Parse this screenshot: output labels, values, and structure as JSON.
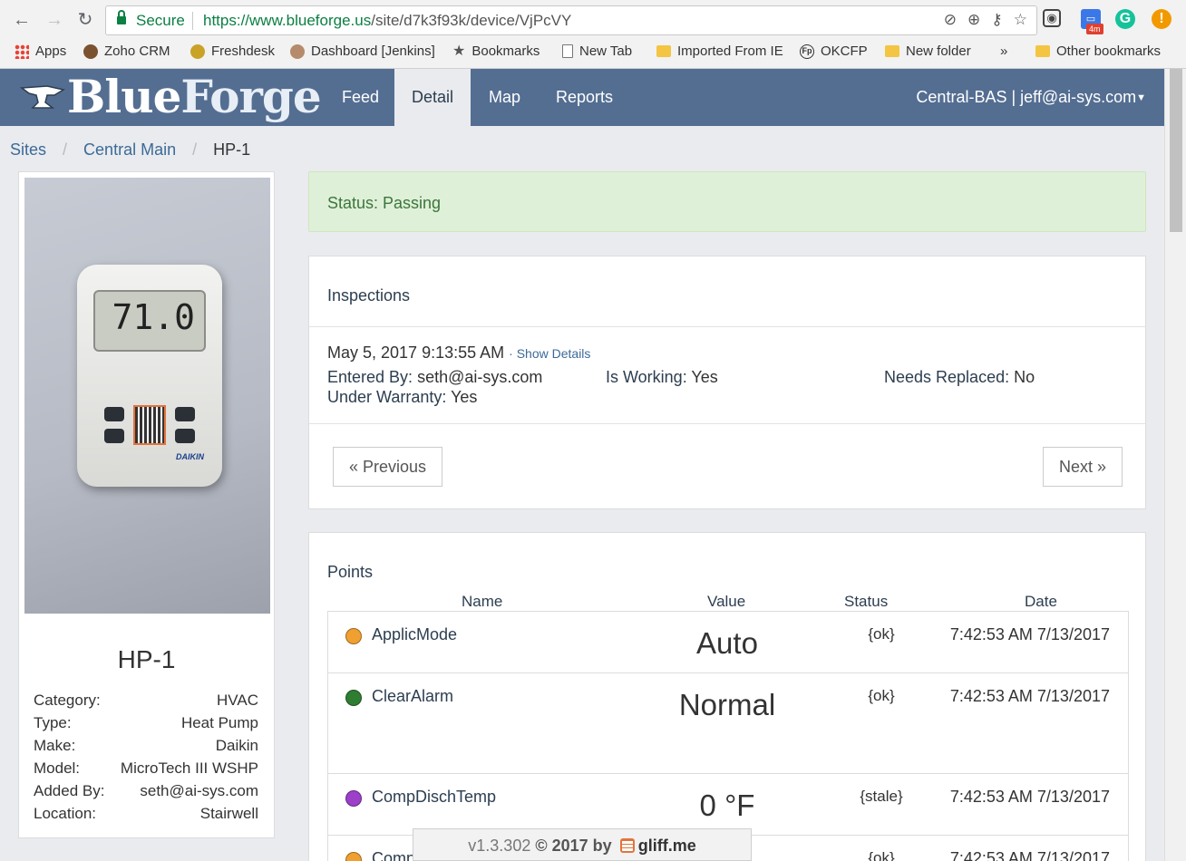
{
  "browser": {
    "secure_label": "Secure",
    "url_host": "https://www.blueforge.us",
    "url_path": "/site/d7k3f93k/device/VjPcVY",
    "bookmarks": [
      "Apps",
      "Zoho CRM",
      "Freshdesk",
      "Dashboard [Jenkins]",
      "Bookmarks",
      "New Tab",
      "Imported From IE",
      "OKCFP",
      "New folder",
      "»",
      "Other bookmarks"
    ],
    "ext_badge": "4m"
  },
  "header": {
    "logo_blue": "Blue",
    "logo_forge": "Forge",
    "nav": [
      "Feed",
      "Detail",
      "Map",
      "Reports"
    ],
    "account": "Central-BAS | jeff@ai-sys.com"
  },
  "breadcrumb": [
    "Sites",
    "Central Main",
    "HP-1"
  ],
  "device": {
    "photo_temp": "71.0",
    "photo_brand": "DAIKIN",
    "name": "HP-1",
    "specs": [
      {
        "label": "Category:",
        "value": "HVAC"
      },
      {
        "label": "Type:",
        "value": "Heat Pump"
      },
      {
        "label": "Make:",
        "value": "Daikin"
      },
      {
        "label": "Model:",
        "value": "MicroTech III WSHP"
      },
      {
        "label": "Added By:",
        "value": "seth@ai-sys.com"
      },
      {
        "label": "Location:",
        "value": "Stairwell"
      }
    ]
  },
  "status": "Status: Passing",
  "inspections": {
    "title": "Inspections",
    "date": "May 5, 2017 9:13:55 AM",
    "show_details": "· Show Details",
    "entered_by_label": "Entered By:",
    "entered_by": "seth@ai-sys.com",
    "is_working_label": "Is Working:",
    "is_working": "Yes",
    "needs_replaced_label": "Needs Replaced:",
    "needs_replaced": "No",
    "warranty_label": "Under Warranty:",
    "warranty": "Yes",
    "prev": "« Previous",
    "next": "Next »"
  },
  "points": {
    "title": "Points",
    "headers": [
      "Name",
      "Value",
      "Status",
      "Date"
    ],
    "rows": [
      {
        "name": "ApplicMode",
        "value": "Auto",
        "status": "{ok}",
        "date": "7:42:53 AM 7/13/2017",
        "color": "#f0a030"
      },
      {
        "name": "ClearAlarm",
        "value": "Normal",
        "status": "{ok}",
        "date": "7:42:53 AM 7/13/2017",
        "color": "#2e7d32"
      },
      {
        "name": "CompDischTemp",
        "value": "0 °F",
        "status": "{stale}",
        "date": "7:42:53 AM 7/13/2017",
        "color": "#9c3fc9"
      },
      {
        "name": "Comp",
        "value": "",
        "status": "{ok}",
        "date": "7:42:53 AM 7/13/2017",
        "color": "#f0a030"
      }
    ]
  },
  "footer": {
    "version": "v1.3.302",
    "copy": "© 2017 by",
    "brand": "gliff.me"
  }
}
